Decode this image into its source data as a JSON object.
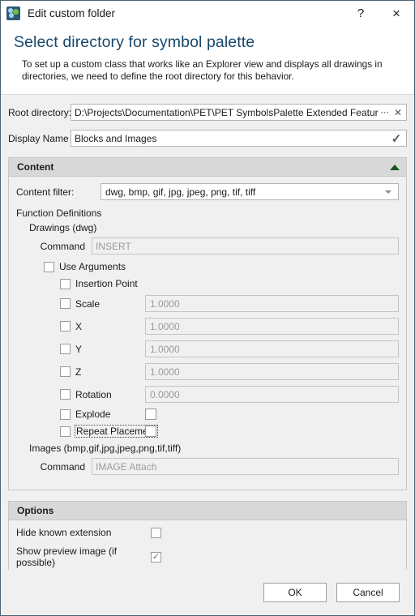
{
  "window": {
    "title": "Edit custom folder",
    "icon": "symbol-palette-icon",
    "help_label": "?",
    "close_label": "×"
  },
  "intro": {
    "heading": "Select directory for symbol palette",
    "description": "To set up a custom class that works like an Explorer view and displays all drawings in directories, we need to define the root directory for this behavior."
  },
  "fields": {
    "root_directory": {
      "label": "Root directory:",
      "value": "D:\\Projects\\Documentation\\PET\\PET SymbolsPalette Extended Features\\Blocks",
      "browse_label": "⋯",
      "clear_label": "✕"
    },
    "display_name": {
      "label": "Display Name",
      "value": "Blocks and Images",
      "validation_label": "✓"
    }
  },
  "content_section": {
    "header": "Content",
    "collapse_icon": "collapse-up-arrow",
    "content_filter": {
      "label": "Content filter:",
      "value": "dwg, bmp, gif, jpg, jpeg, png, tif, tiff"
    },
    "function_definitions_title": "Function Definitions",
    "drawings": {
      "title": "Drawings (dwg)",
      "command_label": "Command",
      "command_placeholder": "INSERT",
      "use_arguments": {
        "label": "Use Arguments",
        "checked": false
      },
      "arguments": [
        {
          "label": "Insertion Point",
          "checked": false,
          "value": null,
          "value_type": "none"
        },
        {
          "label": "Scale",
          "checked": false,
          "value": "1.0000",
          "value_type": "text"
        },
        {
          "label": "X",
          "checked": false,
          "value": "1.0000",
          "value_type": "text"
        },
        {
          "label": "Y",
          "checked": false,
          "value": "1.0000",
          "value_type": "text"
        },
        {
          "label": "Z",
          "checked": false,
          "value": "1.0000",
          "value_type": "text"
        },
        {
          "label": "Rotation",
          "checked": false,
          "value": "0.0000",
          "value_type": "text"
        },
        {
          "label": "Explode",
          "checked": false,
          "value": "",
          "value_type": "checkbox"
        },
        {
          "label": "Repeat Placement",
          "checked": false,
          "value": "",
          "value_type": "checkbox",
          "focused": true
        }
      ]
    },
    "images": {
      "title": "Images (bmp,gif,jpg,jpeg,png,tif,tiff)",
      "command_label": "Command",
      "command_placeholder": "IMAGE Attach"
    }
  },
  "options_section": {
    "header": "Options",
    "options": [
      {
        "label": "Hide known extension",
        "checked": false
      },
      {
        "label": "Show preview image (if possible)",
        "checked": true
      }
    ]
  },
  "footer": {
    "ok_label": "OK",
    "cancel_label": "Cancel"
  },
  "colors": {
    "title_accent": "#18486b",
    "group_header_bg": "#d8d8d8",
    "collapse_arrow": "#11571f",
    "body_bg": "#f0f0f0"
  }
}
